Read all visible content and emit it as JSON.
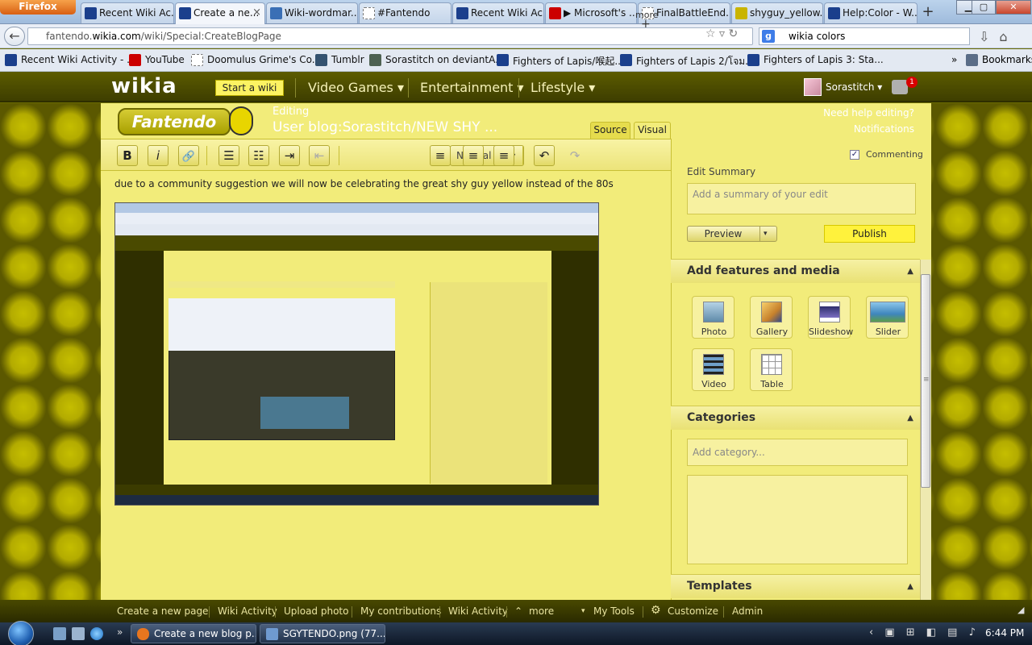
{
  "browser": {
    "menu_label": "Firefox",
    "tabs": [
      {
        "title": "Recent Wiki Ac...",
        "icon": "wikia-favicon",
        "color": "#1b3f8c"
      },
      {
        "title": "Create a ne...",
        "icon": "wikia-favicon",
        "color": "#1b3f8c",
        "active": true
      },
      {
        "title": "Wiki-wordmar...",
        "icon": "image-favicon",
        "color": "#3a6fb5"
      },
      {
        "title": "#Fantendo",
        "icon": "blank-page-icon",
        "color": "#ffffff"
      },
      {
        "title": "Recent Wiki Ac...",
        "icon": "wikia-favicon",
        "color": "#1b3f8c"
      },
      {
        "title": "▶ Microsoft's ...",
        "icon": "youtube-icon",
        "color": "#cc0000"
      },
      {
        "title": "FinalBattleEnd...",
        "icon": "blank-page-icon",
        "color": "#ffffff"
      },
      {
        "title": "shyguy_yellow...",
        "icon": "image-favicon",
        "color": "#c9b400"
      },
      {
        "title": "Help:Color - W...",
        "icon": "wikia-favicon",
        "color": "#1b3f8c"
      }
    ],
    "close_tab_glyph": "×",
    "new_tab_glyph": "+",
    "window_controls": {
      "minimize": "▁",
      "maximize": "▢",
      "close": "✕"
    },
    "url_prefix": "fantendo.",
    "url_domain": "wikia.com",
    "url_path": "/wiki/Special:CreateBlogPage",
    "search_engine_letter": "g",
    "search_value": "wikia colors",
    "bookmarks": [
      {
        "label": "Recent Wiki Activity - ...",
        "icon": "wikia-favicon",
        "color": "#1b3f8c"
      },
      {
        "label": "YouTube",
        "icon": "youtube-icon",
        "color": "#cc0000"
      },
      {
        "label": "Doomulus Grime's Co...",
        "icon": "blank-page-icon",
        "color": "#ffffff"
      },
      {
        "label": "Tumblr",
        "icon": "tumblr-icon",
        "color": "#34526f"
      },
      {
        "label": "Sorastitch on deviantA...",
        "icon": "deviantart-icon",
        "color": "#4e6252"
      },
      {
        "label": "Fighters of Lapis/喉起...",
        "icon": "wikia-favicon",
        "color": "#1b3f8c"
      },
      {
        "label": "Fighters of Lapis 2/โจม...",
        "icon": "wikia-favicon",
        "color": "#1b3f8c"
      },
      {
        "label": "Fighters of Lapis 3: Sta...",
        "icon": "wikia-favicon",
        "color": "#1b3f8c"
      }
    ],
    "bookmarks_overflow": "»",
    "bookmarks_menu": "Bookmarks"
  },
  "wikia": {
    "logo": "wikia",
    "start_wiki": "Start a wiki",
    "hubs": [
      "Video Games ▾",
      "Entertainment ▾",
      "Lifestyle ▾"
    ],
    "username": "Sorastitch ▾",
    "notification_count": "1"
  },
  "editor": {
    "wiki_wordmark": "Fantendo",
    "heading": "Editing",
    "title": "User blog:Sorastitch/NEW SHY ...",
    "help_link": "Need help editing?",
    "notifications_link": "Notifications",
    "mode_tabs": [
      "Source",
      "Visual"
    ],
    "toolbar": {
      "bold": "B",
      "italic": "i",
      "link": "🔗",
      "bullets": "☰",
      "numbers": "☷",
      "indent": "⇥",
      "outdent": "⇤",
      "format": "Normal t... ▾",
      "align_left": "≡",
      "align_center": "≡",
      "align_right": "≡",
      "undo": "↶",
      "redo": "↷",
      "more": "more",
      "more_plus": "+"
    },
    "body_text": "due to a community suggestion we will now be celebrating the great shy guy yellow instead of the 80s"
  },
  "rail": {
    "commenting_label": "Commenting",
    "commenting_checked": "✓",
    "edit_summary_label": "Edit Summary",
    "edit_summary_placeholder": "Add a summary of your edit",
    "preview": "Preview",
    "preview_arrow": "▾",
    "publish": "Publish",
    "features_header": "Add features and media",
    "features": [
      {
        "label": "Photo",
        "icon": "photo-icon",
        "color": "#6f9ab8"
      },
      {
        "label": "Gallery",
        "icon": "gallery-icon",
        "color": "#e0a040"
      },
      {
        "label": "Slideshow",
        "icon": "slideshow-icon",
        "color": "#3b3b7a"
      },
      {
        "label": "Slider",
        "icon": "slider-icon",
        "color": "#7ab6d8"
      },
      {
        "label": "Video",
        "icon": "video-icon",
        "color": "#4d7fa8"
      },
      {
        "label": "Table",
        "icon": "table-icon",
        "color": "#ffffff"
      }
    ],
    "categories_header": "Categories",
    "category_placeholder": "Add category...",
    "templates_header": "Templates",
    "collapse_glyph": "▲"
  },
  "wiki_toolbar": {
    "items": [
      "Create a new page",
      "Wiki Activity",
      "Upload photo",
      "My contributions",
      "Wiki Activity",
      "more",
      "My Tools",
      "Customize",
      "Admin"
    ],
    "more_glyph": "⌃",
    "customize_glyph": "⚙"
  },
  "taskbar": {
    "tasks": [
      {
        "label": "Create a new blog p...",
        "icon": "firefox-icon",
        "color": "#e8761e"
      },
      {
        "label": "SGYTENDO.png (77....",
        "icon": "paint-icon",
        "color": "#6f9ad0"
      }
    ],
    "quicklaunch_more": "»",
    "tray": "‹ ▣ ⊞ ◧ ▤ ♪",
    "clock": "6:44 PM"
  }
}
